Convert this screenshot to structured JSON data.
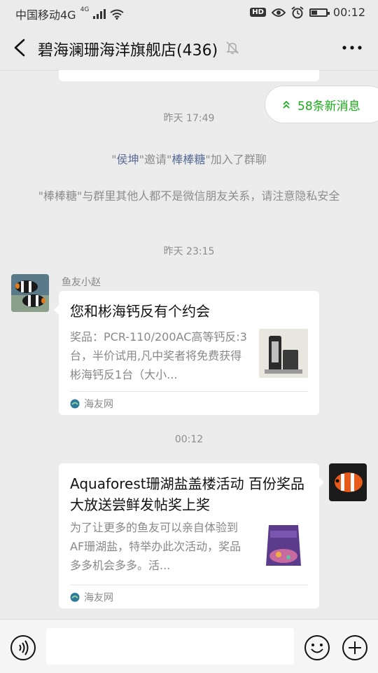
{
  "status_bar": {
    "carrier": "中国移动4G",
    "network_tag": "4G",
    "hd_label": "HD",
    "time": "00:12",
    "battery_level": 0.45
  },
  "header": {
    "title": "碧海澜珊海洋旗舰店(436)"
  },
  "new_messages_label": "58条新消息",
  "timestamps": [
    "昨天 17:49",
    "昨天 23:15",
    "00:12"
  ],
  "system_invite": {
    "inviter": "侯坤",
    "verb": "邀请",
    "invitee": "棒棒糖",
    "suffix": "加入了群聊",
    "q1": "\"",
    "q2": "\"",
    "q3": "\"",
    "q4": "\""
  },
  "system_warning": "\"棒棒糖\"与群里其他人都不是微信朋友关系，请注意隐私安全",
  "messages": [
    {
      "sender": "鱼友小赵",
      "title": "您和彬海钙反有个约会",
      "desc": "奖品：PCR-110/200AC高等钙反:3台，半价试用,凡中奖者将免费获得彬海钙反1台（大小...",
      "source": "海友网"
    },
    {
      "title": "Aquaforest珊湖盐盖楼活动 百份奖品大放送尝鲜发帖奖上奖",
      "desc": "为了让更多的鱼友可以亲自体验到AF珊湖盐，特举办此次活动，奖品多多机会多多。活...",
      "source": "海友网"
    }
  ],
  "colors": {
    "accent_green": "#1aad19",
    "name_link": "#576b95",
    "background": "#ececec"
  },
  "icons": [
    "back-arrow-icon",
    "mute-bell-icon",
    "more-icon",
    "double-chevron-up-icon",
    "voice-icon",
    "emoji-icon",
    "plus-icon",
    "haiyou-logo-icon"
  ]
}
